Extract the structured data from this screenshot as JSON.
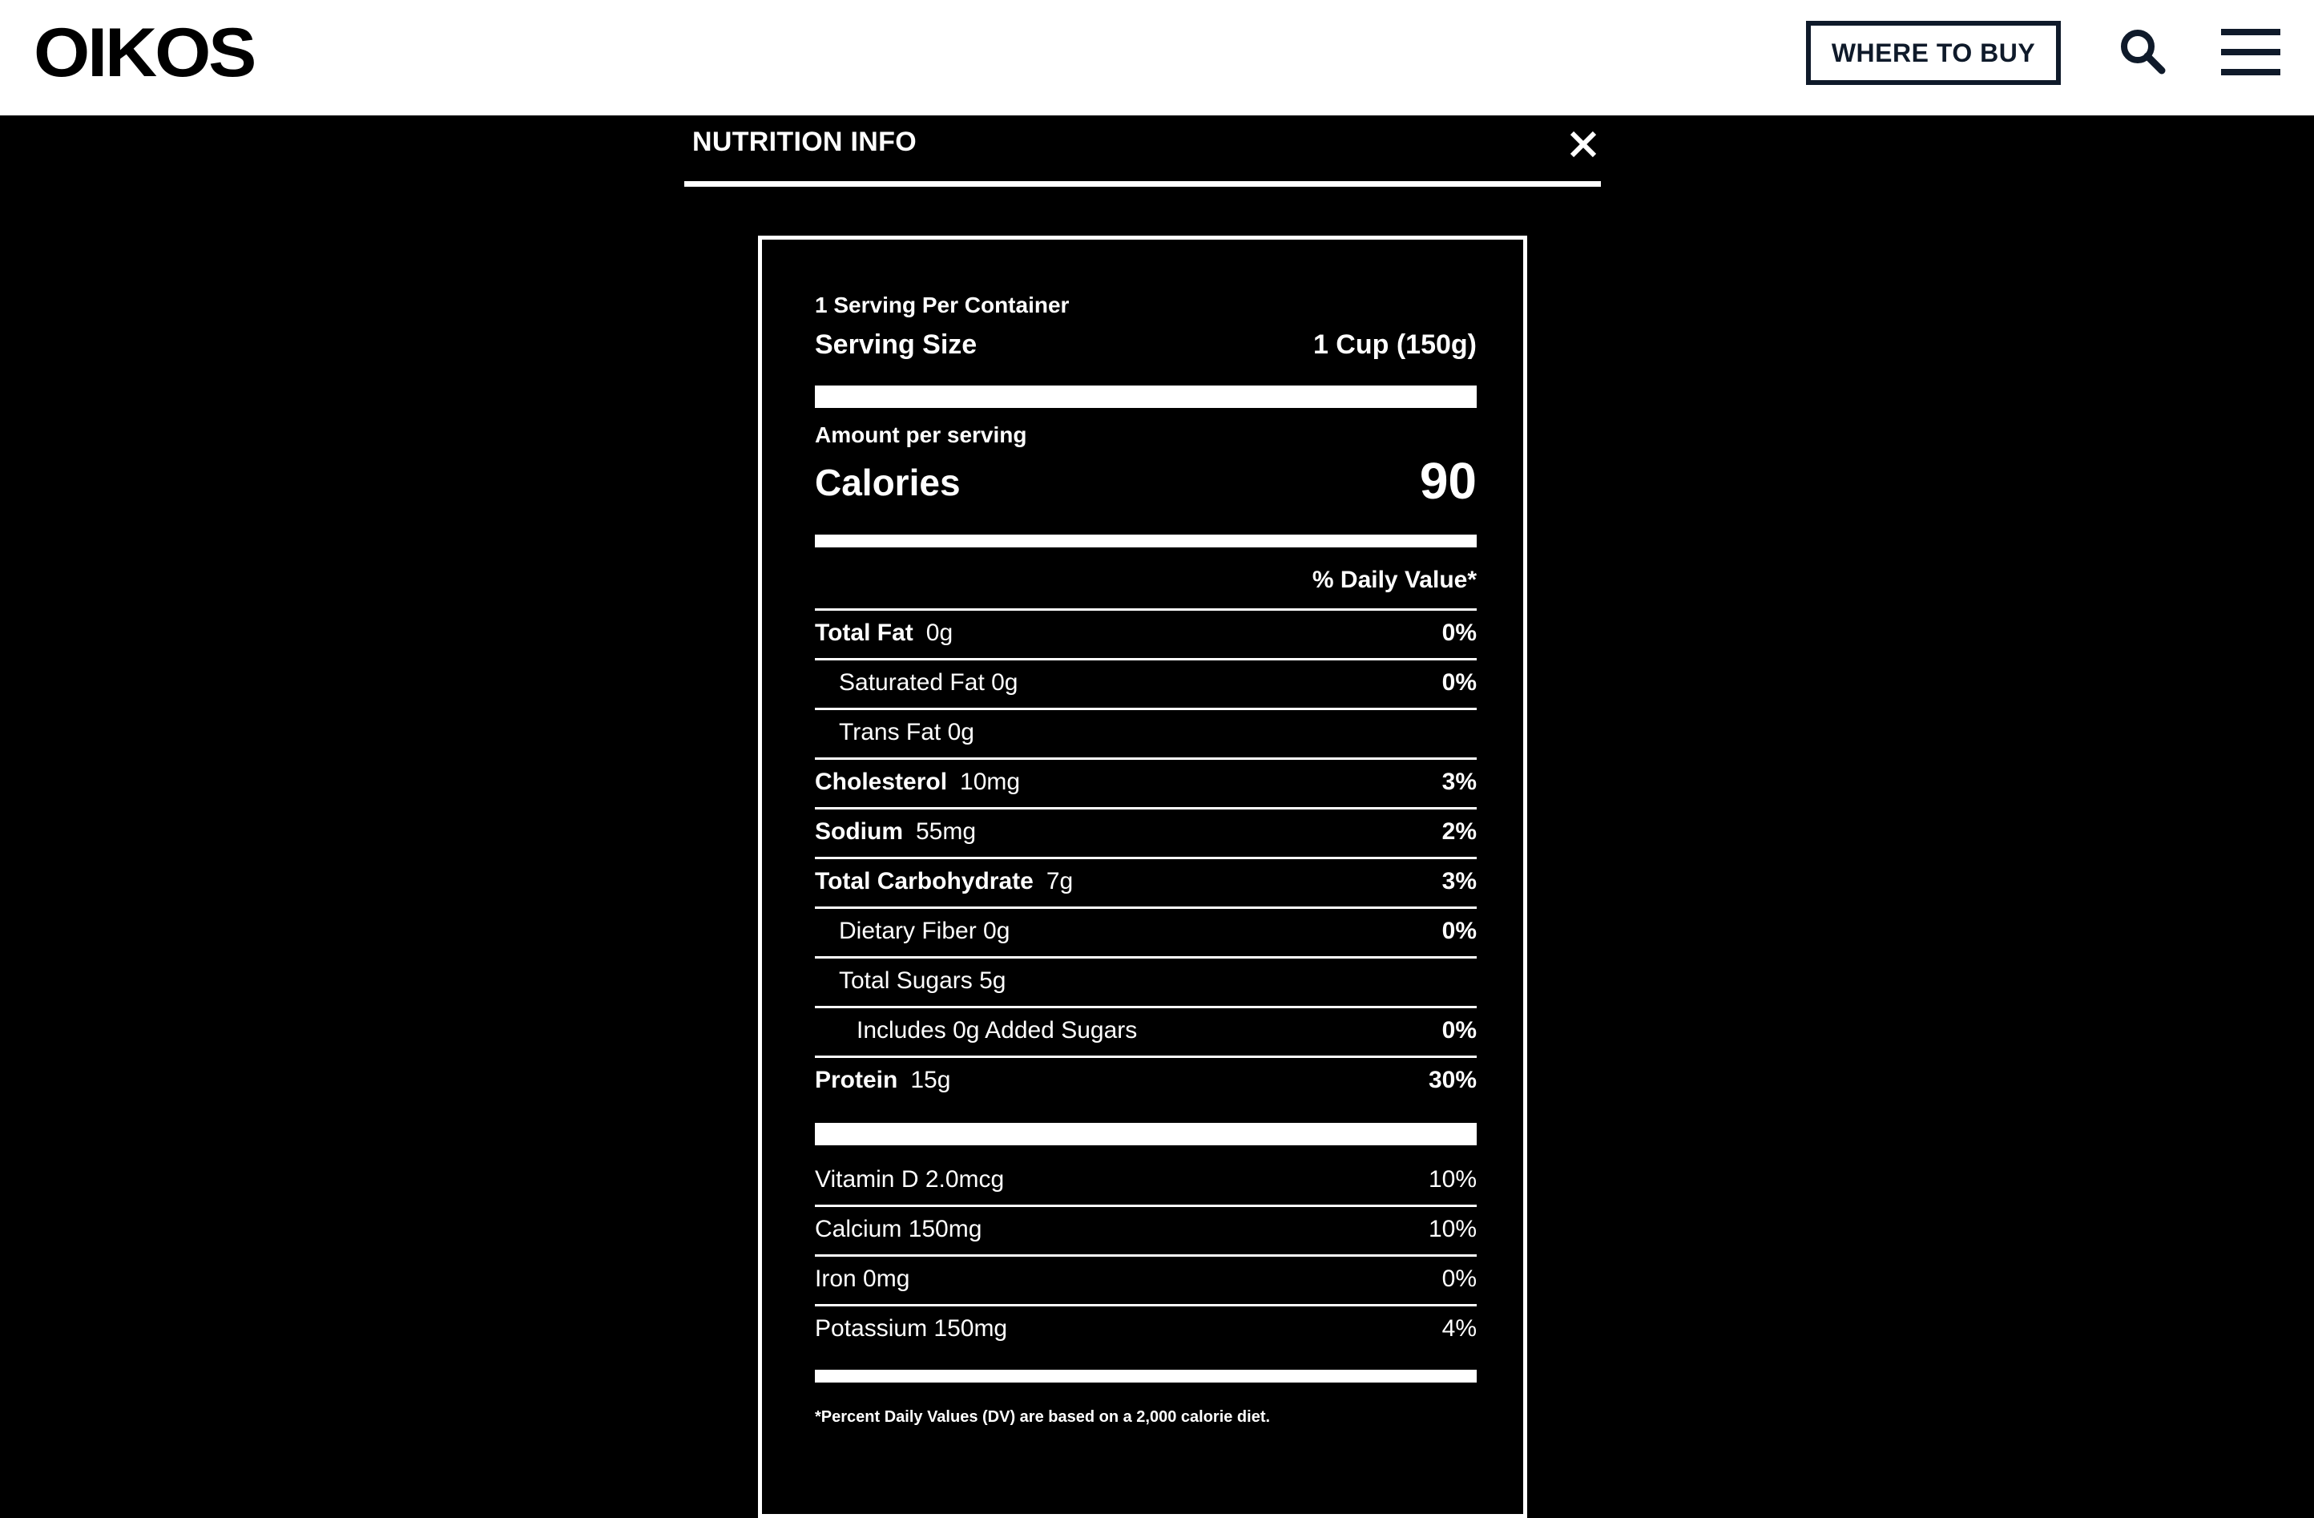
{
  "header": {
    "logo": "OIKOS",
    "where_to_buy": "WHERE TO BUY"
  },
  "icons": {
    "search": "search-icon",
    "menu": "hamburger-menu-icon",
    "close": "close-icon"
  },
  "modal": {
    "title": "NUTRITION INFO",
    "close": "×"
  },
  "nutrition": {
    "servings": "1 Serving Per Container",
    "serving_size_label": "Serving Size",
    "serving_size_value": "1 Cup (150g)",
    "amount_per_serving": "Amount per serving",
    "calories_label": "Calories",
    "calories_value": "90",
    "dv_header": "% Daily Value*",
    "rows": [
      {
        "label": "Total Fat",
        "amount": "0g",
        "dv": "0%"
      },
      {
        "label": "Saturated Fat 0g",
        "dv": "0%"
      },
      {
        "label": "Trans Fat 0g",
        "dv": ""
      },
      {
        "label": "Cholesterol",
        "amount": "10mg",
        "dv": "3%"
      },
      {
        "label": "Sodium",
        "amount": "55mg",
        "dv": "2%"
      },
      {
        "label": "Total Carbohydrate",
        "amount": "7g",
        "dv": "3%"
      },
      {
        "label": "Dietary Fiber 0g",
        "dv": "0%"
      },
      {
        "label": "Total Sugars 5g",
        "dv": ""
      },
      {
        "label": "Includes 0g Added Sugars",
        "dv": "0%"
      },
      {
        "label": "Protein",
        "amount": "15g",
        "dv": "30%"
      }
    ],
    "vitamins": [
      {
        "label": "Vitamin D 2.0mcg",
        "dv": "10%"
      },
      {
        "label": "Calcium 150mg",
        "dv": "10%"
      },
      {
        "label": "Iron 0mg",
        "dv": "0%"
      },
      {
        "label": "Potassium 150mg",
        "dv": "4%"
      }
    ],
    "footnote": "*Percent Daily Values (DV) are based on a 2,000 calorie diet."
  },
  "colors": {
    "header_bg": "#ffffff",
    "page_bg": "#000000",
    "brand_navy": "#0f1a2a",
    "text": "#ffffff"
  }
}
